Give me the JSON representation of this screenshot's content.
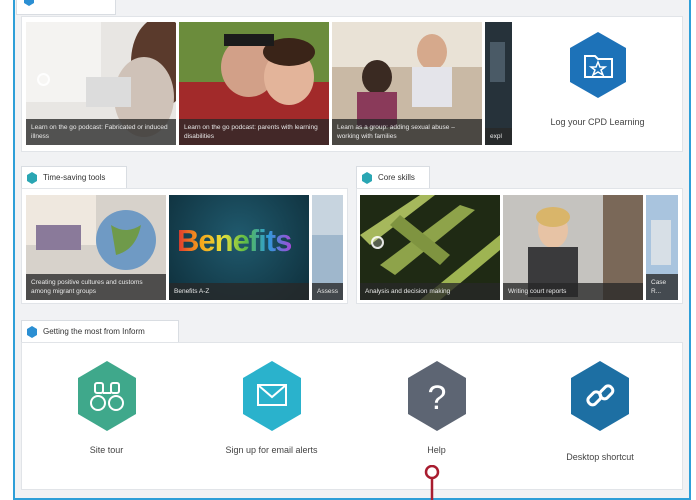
{
  "top_panel": {
    "tiles": [
      {
        "caption": "Learn on the go podcast: Fabricated or induced illness"
      },
      {
        "caption": "Learn on the go podcast: parents with learning disabilities"
      },
      {
        "caption": "Learn as a group: adding sexual abuse – working with families"
      },
      {
        "caption": "expl"
      }
    ],
    "cpd_label": "Log your CPD Learning"
  },
  "time_saving": {
    "title": "Time-saving tools",
    "tiles": [
      {
        "caption": "Creating positive cultures and customs among migrant groups"
      },
      {
        "caption": "Benefits A-Z",
        "banner": "Benefits"
      },
      {
        "caption": "Assess"
      }
    ]
  },
  "core_skills": {
    "title": "Core skills",
    "tiles": [
      {
        "caption": "Analysis and decision making"
      },
      {
        "caption": "Writing court reports"
      },
      {
        "caption": "Case R..."
      }
    ]
  },
  "getting_most": {
    "title": "Getting the most from Inform",
    "features": [
      {
        "label": "Site tour",
        "icon": "binoculars-icon",
        "color": "#3fa88b"
      },
      {
        "label": "Sign up for email alerts",
        "icon": "envelope-icon",
        "color": "#2ab2cc"
      },
      {
        "label": "Help",
        "icon": "question-icon",
        "color": "#5d6573"
      },
      {
        "label": "Desktop shortcut",
        "icon": "link-icon",
        "color": "#1d6fa3"
      }
    ]
  },
  "colors": {
    "frame_border": "#2e9fd8",
    "pin": "#a81c2f",
    "tab_hex_teal": "#2aa6b3",
    "tab_hex_blue": "#2b8fd3"
  }
}
